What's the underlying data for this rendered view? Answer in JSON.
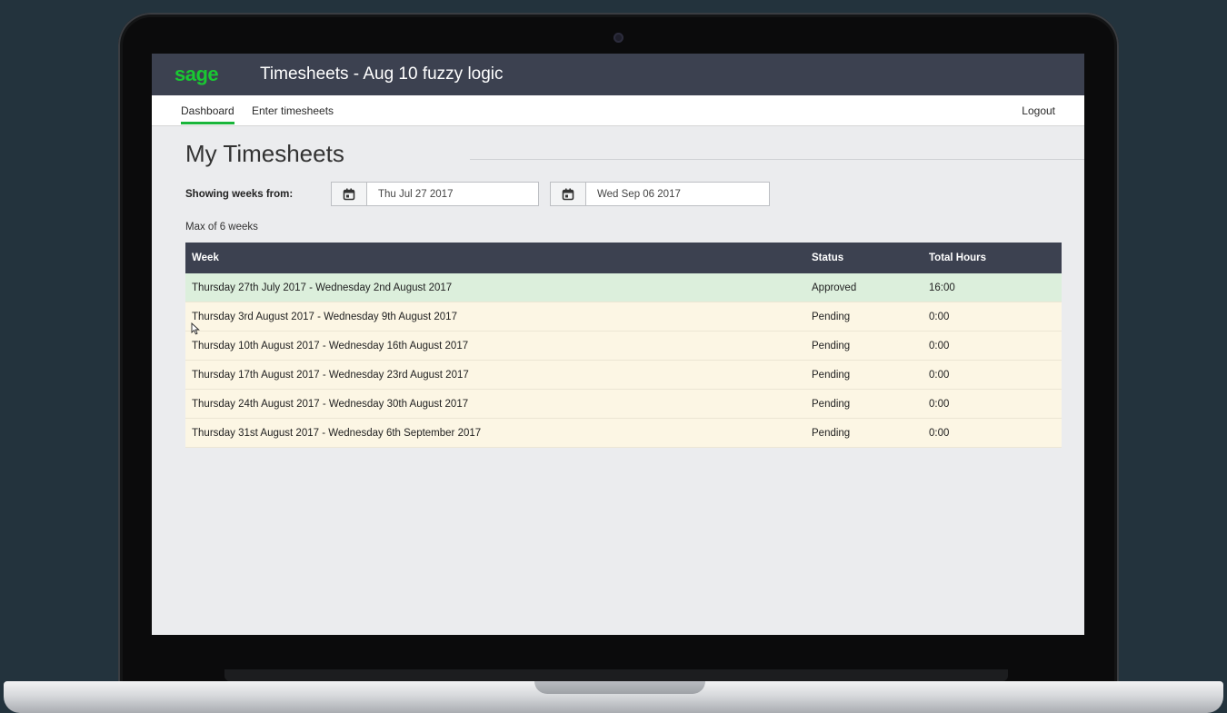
{
  "app": {
    "logo": "sage",
    "title": "Timesheets - Aug 10 fuzzy logic",
    "brand_color": "#19c832",
    "header_color": "#3c4150"
  },
  "nav": {
    "items": [
      {
        "label": "Dashboard",
        "active": true
      },
      {
        "label": "Enter timesheets",
        "active": false
      }
    ],
    "logout_label": "Logout"
  },
  "page": {
    "title": "My Timesheets",
    "range_label": "Showing weeks from:",
    "from_date": "Thu Jul 27 2017",
    "to_date": "Wed Sep 06 2017",
    "max_note": "Max of 6 weeks"
  },
  "table": {
    "columns": [
      "Week",
      "Status",
      "Total Hours"
    ],
    "rows": [
      {
        "week": "Thursday 27th July 2017 - Wednesday 2nd August 2017",
        "status": "Approved",
        "hours": "16:00"
      },
      {
        "week": "Thursday 3rd August 2017 - Wednesday 9th August 2017",
        "status": "Pending",
        "hours": "0:00"
      },
      {
        "week": "Thursday 10th August 2017 - Wednesday 16th August 2017",
        "status": "Pending",
        "hours": "0:00"
      },
      {
        "week": "Thursday 17th August 2017 - Wednesday 23rd August 2017",
        "status": "Pending",
        "hours": "0:00"
      },
      {
        "week": "Thursday 24th August 2017 - Wednesday 30th August 2017",
        "status": "Pending",
        "hours": "0:00"
      },
      {
        "week": "Thursday 31st August 2017 - Wednesday 6th September 2017",
        "status": "Pending",
        "hours": "0:00"
      }
    ],
    "status_colors": {
      "Approved": "#dcefdc",
      "Pending": "#fcf6e4"
    }
  }
}
